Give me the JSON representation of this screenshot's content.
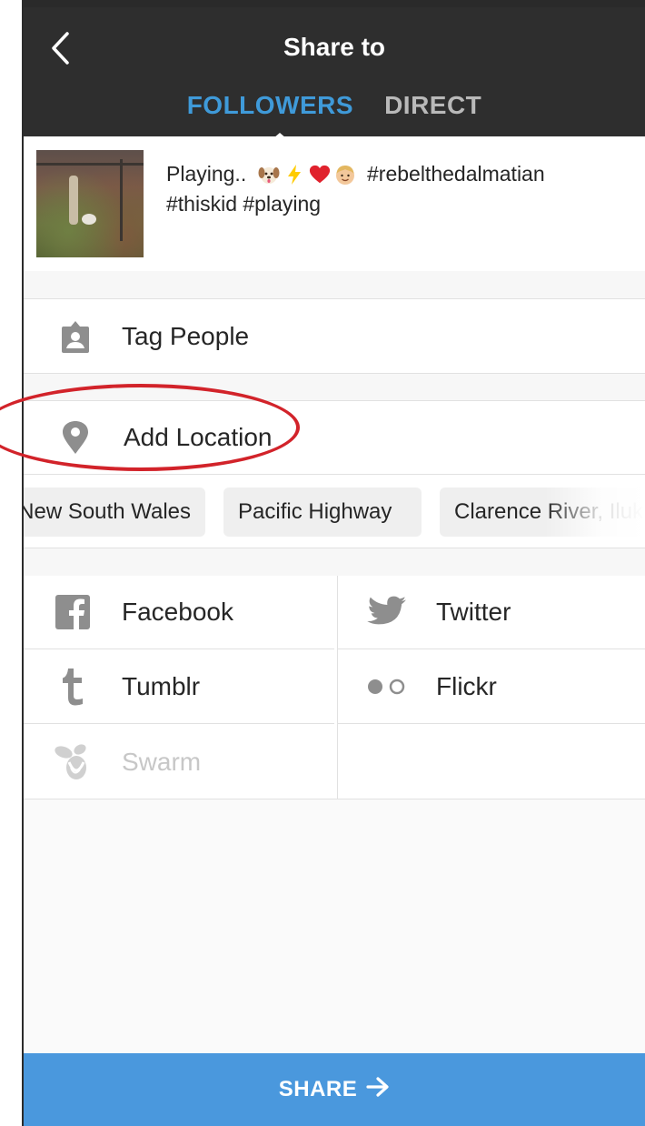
{
  "header": {
    "title": "Share to",
    "back_icon": "chevron-left-icon",
    "tabs": [
      {
        "label": "FOLLOWERS",
        "active": true
      },
      {
        "label": "DIRECT",
        "active": false
      }
    ],
    "colors": {
      "background": "#2e2e2e",
      "active_tab": "#3f9ad9",
      "inactive_tab": "#b9b9b9"
    }
  },
  "post": {
    "caption_start": "Playing..",
    "emojis": [
      "dog-face-icon",
      "lightning-icon",
      "heart-icon",
      "child-face-icon"
    ],
    "caption_tags": "#rebelthedalmatian",
    "caption_line2": "#thiskid #playing"
  },
  "options": {
    "tag_people": {
      "label": "Tag People",
      "icon": "person-tag-icon"
    },
    "add_location": {
      "label": "Add Location",
      "icon": "location-pin-icon"
    }
  },
  "location_suggestions": [
    "New South Wales",
    "Pacific Highway",
    "Clarence River, Iluka"
  ],
  "share_targets": [
    {
      "label": "Facebook",
      "icon": "facebook-icon",
      "enabled": true
    },
    {
      "label": "Twitter",
      "icon": "twitter-icon",
      "enabled": true
    },
    {
      "label": "Tumblr",
      "icon": "tumblr-icon",
      "enabled": true
    },
    {
      "label": "Flickr",
      "icon": "flickr-icon",
      "enabled": true
    },
    {
      "label": "Swarm",
      "icon": "swarm-icon",
      "enabled": false
    }
  ],
  "share_button": {
    "label": "SHARE",
    "icon": "arrow-right-icon",
    "color": "#4a98dd"
  },
  "annotation": {
    "color": "#d2232a"
  }
}
